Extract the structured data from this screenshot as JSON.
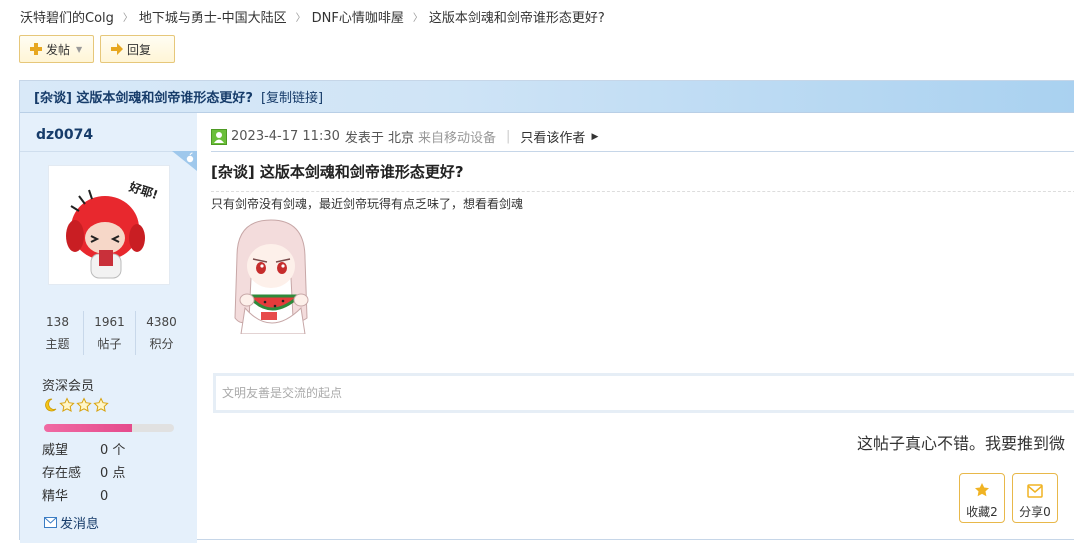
{
  "breadcrumb": [
    "沃特碧们的Colg",
    "地下城与勇士-中国大陆区",
    "DNF心情咖啡屋",
    "这版本剑魂和剑帝谁形态更好?"
  ],
  "toolbar": {
    "post_label": "发帖",
    "reply_label": "回复"
  },
  "thread": {
    "title": "[杂谈] 这版本剑魂和剑帝谁形态更好?",
    "copy_link": "[复制链接]"
  },
  "author": {
    "name": "dz0074",
    "avatar_text": "好耶!",
    "stats": [
      {
        "value": "138",
        "label": "主题"
      },
      {
        "value": "1961",
        "label": "帖子"
      },
      {
        "value": "4380",
        "label": "积分"
      }
    ],
    "rank": "资深会员",
    "level_progress": 0.68,
    "info": [
      {
        "key": "威望",
        "value": "0 个"
      },
      {
        "key": "存在感",
        "value": "0 点"
      },
      {
        "key": "精华",
        "value": "0"
      }
    ],
    "message_link": "发消息"
  },
  "post": {
    "date": "2023-4-17 11:30",
    "posted_in": "发表于 北京",
    "device": "来自移动设备",
    "only_author": "只看该作者",
    "title": "[杂谈] 这版本剑魂和剑帝谁形态更好?",
    "text": "只有剑帝没有剑魂，最近剑帝玩得有点乏味了，想看看剑魂"
  },
  "reply": {
    "placeholder": "文明友善是交流的起点"
  },
  "recommend_text": "这帖子真心不错。我要推到微",
  "actions": {
    "favorite": "收藏2",
    "share": "分享0"
  },
  "colors": {
    "accent_blue": "#173c6a",
    "button_border": "#e6c77a",
    "progress": "#e54b8c"
  }
}
